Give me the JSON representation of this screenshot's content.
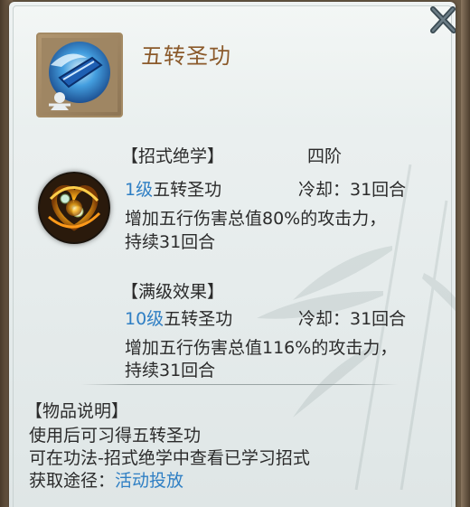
{
  "item": {
    "name": "五转圣功",
    "close_icon": "close-icon",
    "icon": "skill-book-icon"
  },
  "skill": {
    "section_label": "【招式绝学】",
    "tier": "四阶",
    "icon": "golden-swirl-skill-icon",
    "current": {
      "level": "1级",
      "name": "五转圣功",
      "cooldown": "冷却：31回合",
      "desc_line1": "增加五行伤害总值80%的攻击力，",
      "desc_line2": "持续31回合"
    },
    "max": {
      "section_label": "【满级效果】",
      "level": "10级",
      "name": "五转圣功",
      "cooldown": "冷却：31回合",
      "desc_line1": "增加五行伤害总值116%的攻击力，",
      "desc_line2": "持续31回合"
    }
  },
  "description": {
    "section_label": "【物品说明】",
    "line1": "使用后可习得五转圣功",
    "line2": "可在功法-招式绝学中查看已学习招式",
    "source_label": "获取途径：",
    "source_link": "活动投放"
  },
  "colors": {
    "title": "#8b5a2b",
    "link_blue": "#2f7fc4",
    "text": "#2b2b2b",
    "panel_bg": "#eaefef"
  }
}
